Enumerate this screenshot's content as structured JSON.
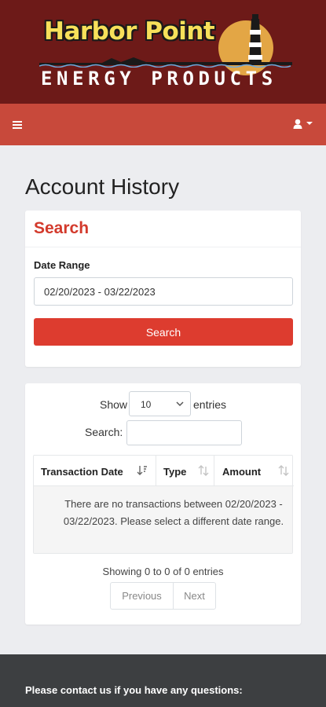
{
  "brand": {
    "logo_line1": "Harbor Point",
    "logo_line2": "ENERGY PRODUCTS"
  },
  "navbar": {
    "menu_icon": "hamburger-menu-icon",
    "user_icon": "user-icon",
    "caret_icon": "caret-down-icon"
  },
  "page": {
    "title": "Account History"
  },
  "search": {
    "heading": "Search",
    "date_range_label": "Date Range",
    "date_range_value": "02/20/2023 - 03/22/2023",
    "button_label": "Search"
  },
  "table": {
    "show_label": "Show",
    "page_length": "10",
    "entries_label": "entries",
    "filter_label": "Search:",
    "filter_value": "",
    "columns": [
      "Transaction Date",
      "Type",
      "Amount"
    ],
    "empty_message": "There are no transactions between 02/20/2023 - 03/22/2023. Please select a different date range.",
    "info": "Showing 0 to 0 of 0 entries",
    "pagination": {
      "previous": "Previous",
      "next": "Next"
    }
  },
  "footer": {
    "contact_text": "Please contact us if you have any questions:"
  },
  "colors": {
    "brand_dark": "#6d1a18",
    "navbar": "#c8493b",
    "accent_red": "#dd3c2f",
    "footer": "#3d3f41"
  }
}
